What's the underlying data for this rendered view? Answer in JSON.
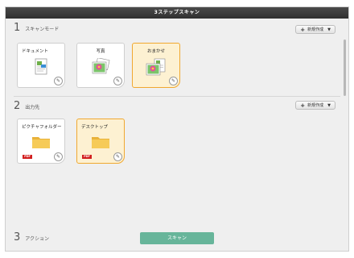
{
  "window": {
    "title": "3ステップスキャン"
  },
  "section1": {
    "number": "1",
    "label": "スキャンモード",
    "new_button": {
      "label": "新規作成",
      "plus": "+",
      "caret": "▼"
    },
    "cards": [
      {
        "label": "ドキュメント",
        "selected": false,
        "icon": "document-icon"
      },
      {
        "label": "写真",
        "selected": false,
        "icon": "photo-icon"
      },
      {
        "label": "おまかせ",
        "selected": true,
        "icon": "auto-icon"
      }
    ]
  },
  "section2": {
    "number": "2",
    "label": "出力先",
    "new_button": {
      "label": "新規作成",
      "plus": "+",
      "caret": "▼"
    },
    "cards": [
      {
        "label": "ピクチャフォルダー",
        "selected": false,
        "badge": "PDF",
        "icon": "folder-icon"
      },
      {
        "label": "デスクトップ",
        "selected": true,
        "badge": "PDF",
        "icon": "folder-icon"
      }
    ]
  },
  "section3": {
    "number": "3",
    "label": "アクション",
    "scan_button": "スキャン"
  },
  "colors": {
    "selected_border": "#f0a830",
    "selected_bg": "#fdf1d2",
    "scan_button": "#67b59a",
    "pdf_badge": "#d21f1f",
    "folder": "#f4c24a"
  }
}
